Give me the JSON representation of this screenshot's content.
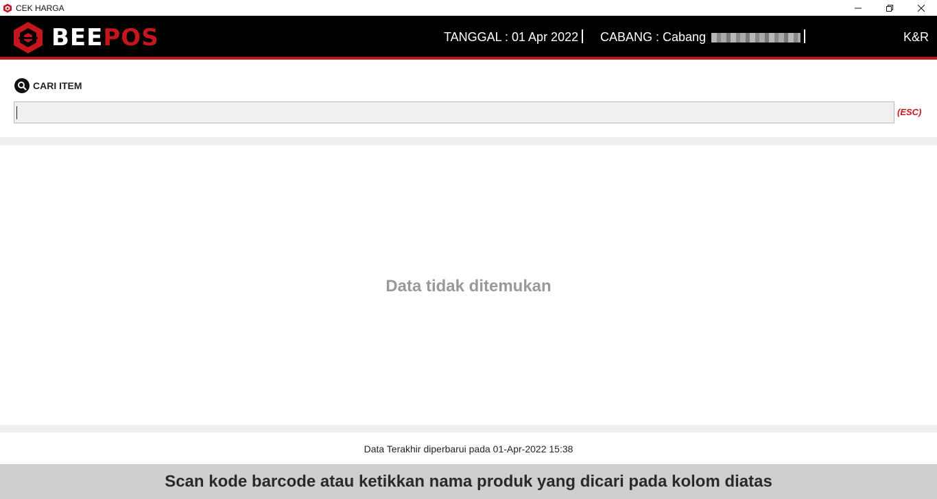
{
  "window": {
    "title": "CEK HARGA",
    "controls": {
      "minimize": "–",
      "restore": "❐",
      "close": "✕"
    }
  },
  "header": {
    "logo_text_a": "BEE",
    "logo_text_b": "POS",
    "date_label": "TANGGAL : 01 Apr 2022",
    "branch_label": "CABANG : Cabang",
    "user": "K&R"
  },
  "search": {
    "label": "CARI ITEM",
    "value": "",
    "esc_hint": "(ESC)",
    "icon": "search-icon"
  },
  "results": {
    "empty_message": "Data tidak ditemukan"
  },
  "status": {
    "last_updated": "Data Terakhir diperbarui pada 01-Apr-2022 15:38"
  },
  "footer": {
    "instruction": "Scan kode barcode atau ketikkan nama produk yang dicari pada kolom diatas"
  },
  "colors": {
    "accent": "#c4161c",
    "header_bg": "#000000",
    "footer_bg": "#cfcfcf"
  }
}
